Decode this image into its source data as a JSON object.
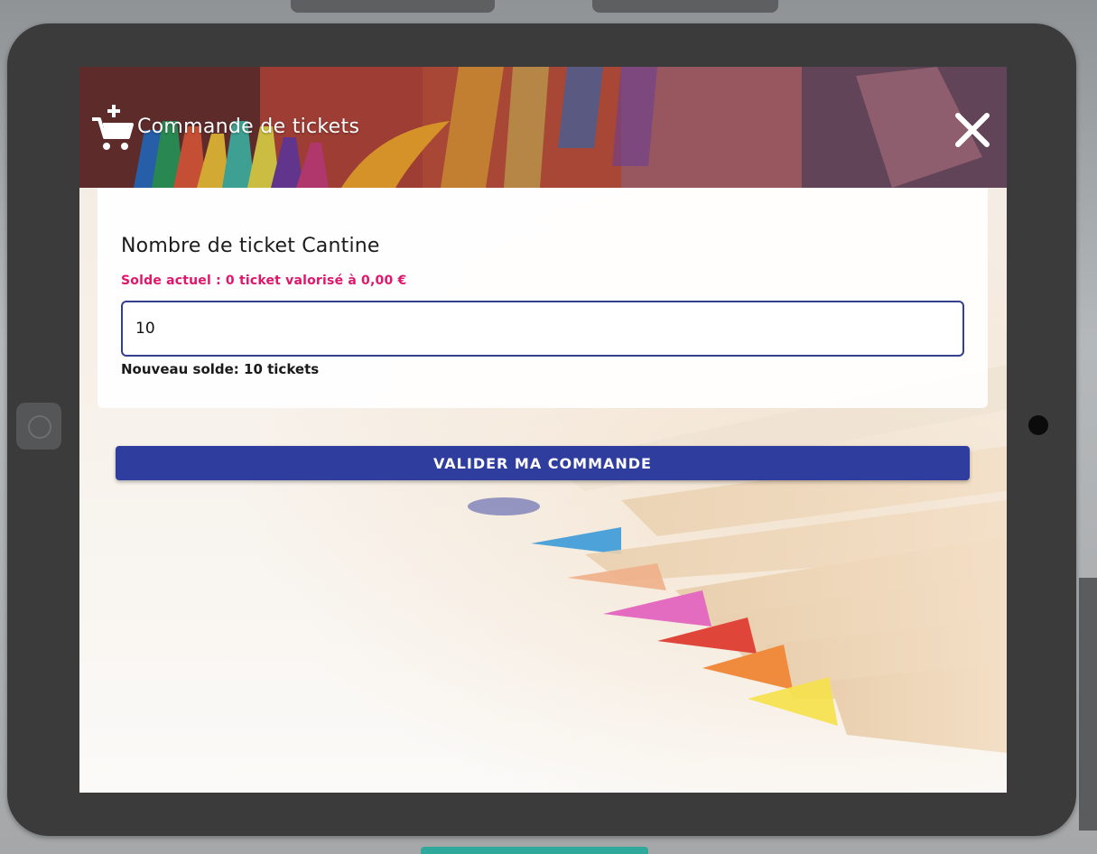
{
  "modal": {
    "title": "Commande de tickets",
    "header_icon": "cart-plus-icon",
    "close_icon": "close-icon"
  },
  "order": {
    "label": "Nombre de ticket Cantine",
    "current_balance": "Solde actuel : 0 ticket valorisé à 0,00 €",
    "input_value": "10",
    "new_balance": "Nouveau solde: 10 tickets"
  },
  "actions": {
    "submit_label": "VALIDER MA COMMANDE"
  },
  "colors": {
    "accent": "#2f3e9e",
    "balance_highlight": "#e0156b",
    "tablet_frame": "#3b3b3b"
  }
}
